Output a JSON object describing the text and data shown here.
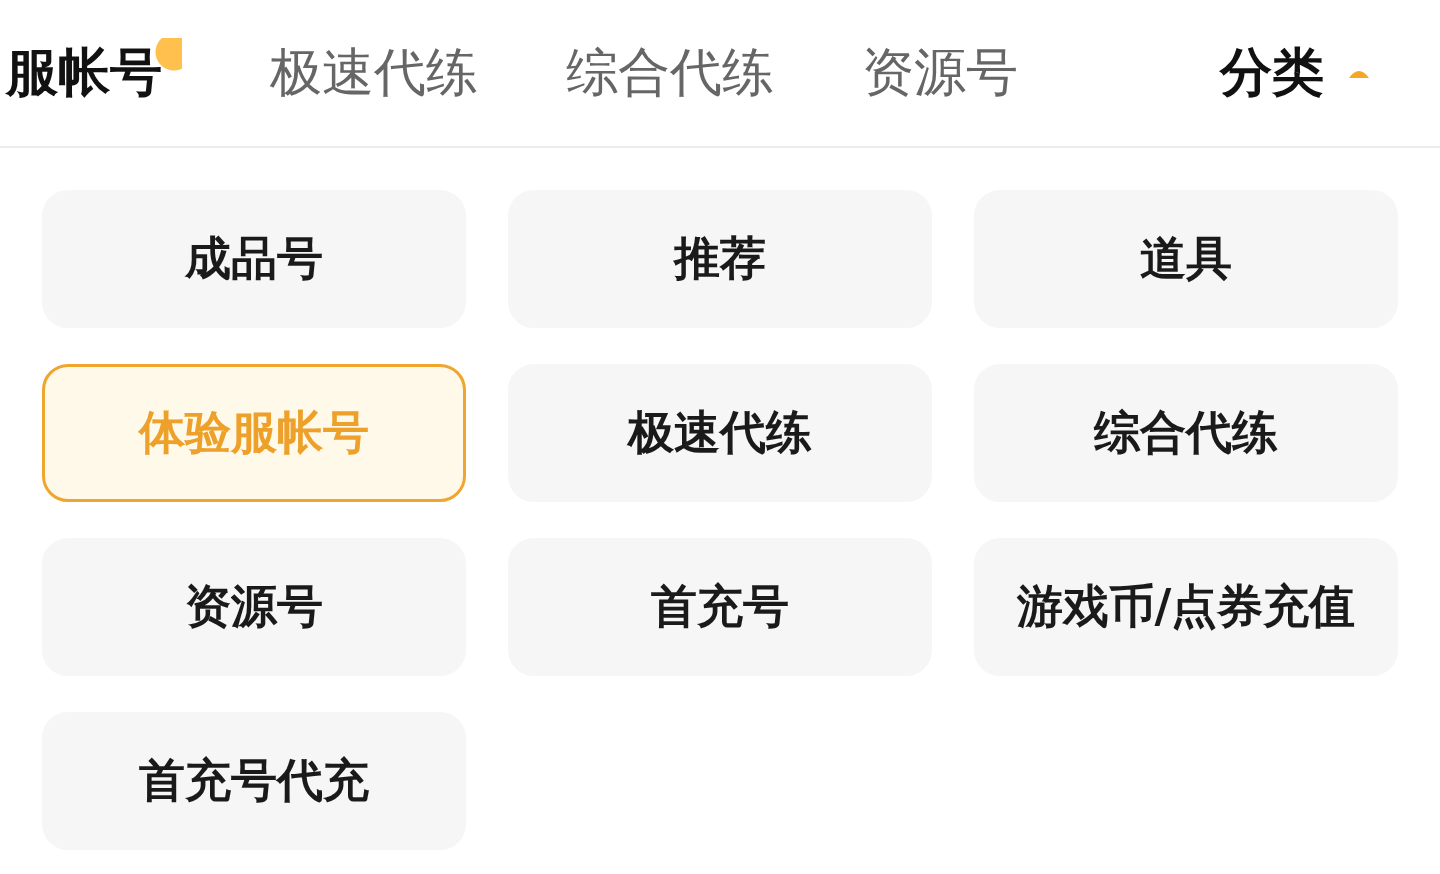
{
  "tabs": [
    {
      "label": "服帐号",
      "selected": true
    },
    {
      "label": "极速代练",
      "selected": false
    },
    {
      "label": "综合代练",
      "selected": false
    },
    {
      "label": "资源号",
      "selected": false
    }
  ],
  "category_toggle": {
    "label": "分类",
    "expanded": true
  },
  "categories": [
    {
      "label": "成品号",
      "selected": false
    },
    {
      "label": "推荐",
      "selected": false
    },
    {
      "label": "道具",
      "selected": false
    },
    {
      "label": "体验服帐号",
      "selected": true
    },
    {
      "label": "极速代练",
      "selected": false
    },
    {
      "label": "综合代练",
      "selected": false
    },
    {
      "label": "资源号",
      "selected": false
    },
    {
      "label": "首充号",
      "selected": false
    },
    {
      "label": "游戏币/点券充值",
      "selected": false
    },
    {
      "label": "首充号代充",
      "selected": false
    }
  ]
}
